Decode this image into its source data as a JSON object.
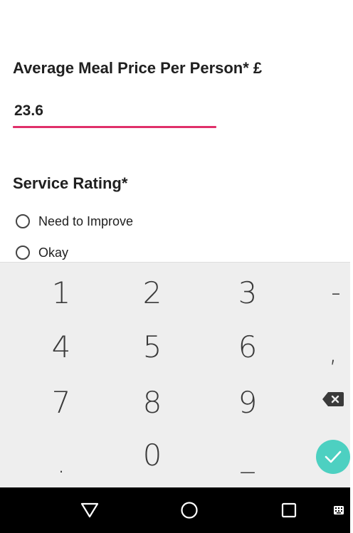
{
  "form": {
    "price_label": "Average Meal Price Per Person* £",
    "price_value": "23.6",
    "rating_label": "Service Rating*",
    "rating_options": [
      {
        "label": "Need to Improve",
        "selected": false
      },
      {
        "label": "Okay",
        "selected": false
      }
    ],
    "accent_color": "#e0306a"
  },
  "keyboard": {
    "keys": [
      "1",
      "2",
      "3",
      "-",
      "4",
      "5",
      "6",
      ",",
      "7",
      "8",
      "9",
      ".",
      "0",
      "_"
    ],
    "backspace_icon": "backspace-icon",
    "done_icon": "checkmark-icon",
    "done_color": "#4dd0c1"
  },
  "navbar": {
    "icons": [
      "back-triangle-icon",
      "home-circle-icon",
      "recents-square-icon",
      "keyboard-switch-icon"
    ]
  }
}
